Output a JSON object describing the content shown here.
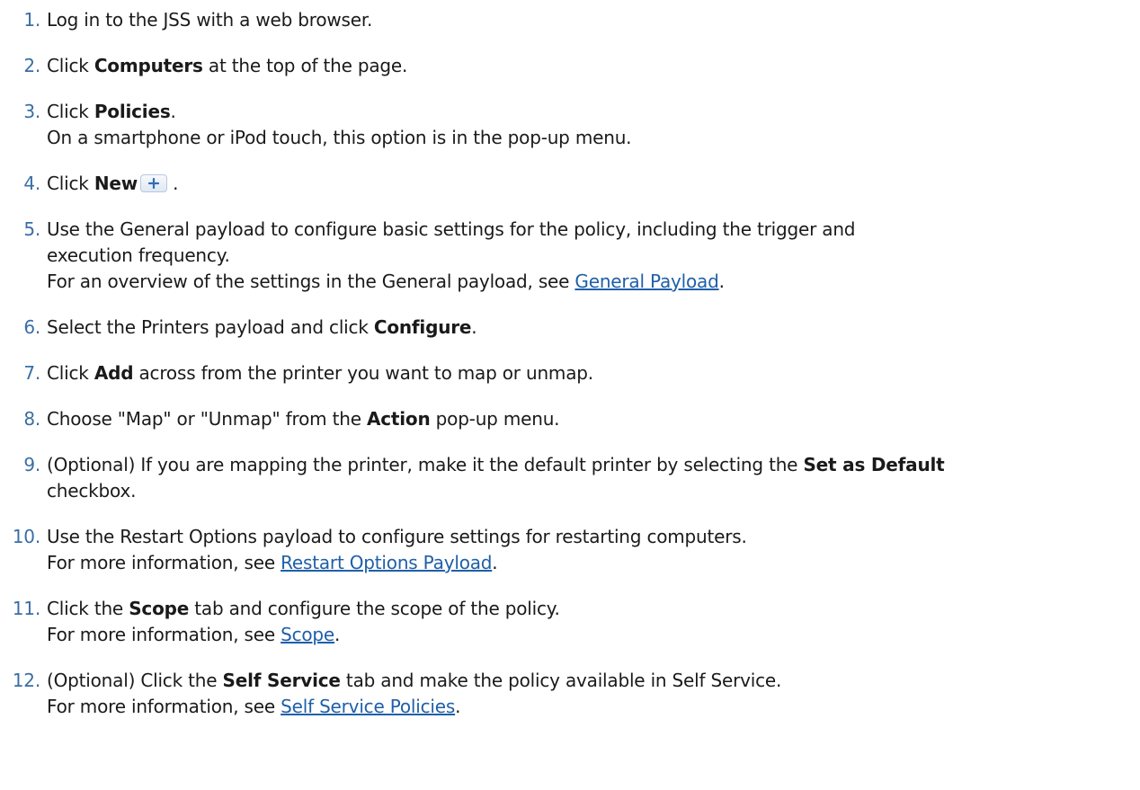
{
  "steps": [
    {
      "num": "1.",
      "text": "Log in to the JSS with a web browser."
    },
    {
      "num": "2.",
      "pre": "Click ",
      "bold": "Computers",
      "post": " at the top of the page."
    },
    {
      "num": "3.",
      "pre": "Click ",
      "bold": "Policies",
      "post": ".",
      "note": "On a smartphone or iPod touch, this option is in the pop-up menu."
    },
    {
      "num": "4.",
      "pre": "Click ",
      "bold": "New",
      "post": " .",
      "icon": "plus-icon"
    },
    {
      "num": "5.",
      "line1": "Use the General payload to configure basic settings for the policy, including the trigger and",
      "line2": "execution frequency.",
      "note_pre": "For an overview of the settings in the General payload, see ",
      "link": "General Payload",
      "note_post": "."
    },
    {
      "num": "6.",
      "pre": "Select the Printers payload and click ",
      "bold": "Configure",
      "post": "."
    },
    {
      "num": "7.",
      "pre": "Click ",
      "bold": "Add",
      "post": " across from the printer you want to map or unmap."
    },
    {
      "num": "8.",
      "pre": "Choose \"Map\" or \"Unmap\" from the ",
      "bold": "Action",
      "post": " pop-up menu."
    },
    {
      "num": "9.",
      "pre": "(Optional) If you are mapping the printer, make it the default printer by selecting the ",
      "bold": "Set as Default",
      "line2": "checkbox."
    },
    {
      "num": "10.",
      "text": "Use the Restart Options payload to configure settings for restarting computers.",
      "note_pre": "For more information, see ",
      "link": "Restart Options Payload",
      "note_post": "."
    },
    {
      "num": "11.",
      "pre": "Click the ",
      "bold": "Scope",
      "post": " tab and configure the scope of the policy.",
      "note_pre": "For more information, see ",
      "link": "Scope",
      "note_post": "."
    },
    {
      "num": "12.",
      "pre": "(Optional) Click the ",
      "bold": "Self Service",
      "post": " tab and make the policy available in Self Service.",
      "note_pre": "For more information, see ",
      "link": "Self Service Policies",
      "note_post": "."
    }
  ],
  "colors": {
    "number": "#3a6ea5",
    "link": "#1f5fa8",
    "text": "#1a1a1a"
  }
}
